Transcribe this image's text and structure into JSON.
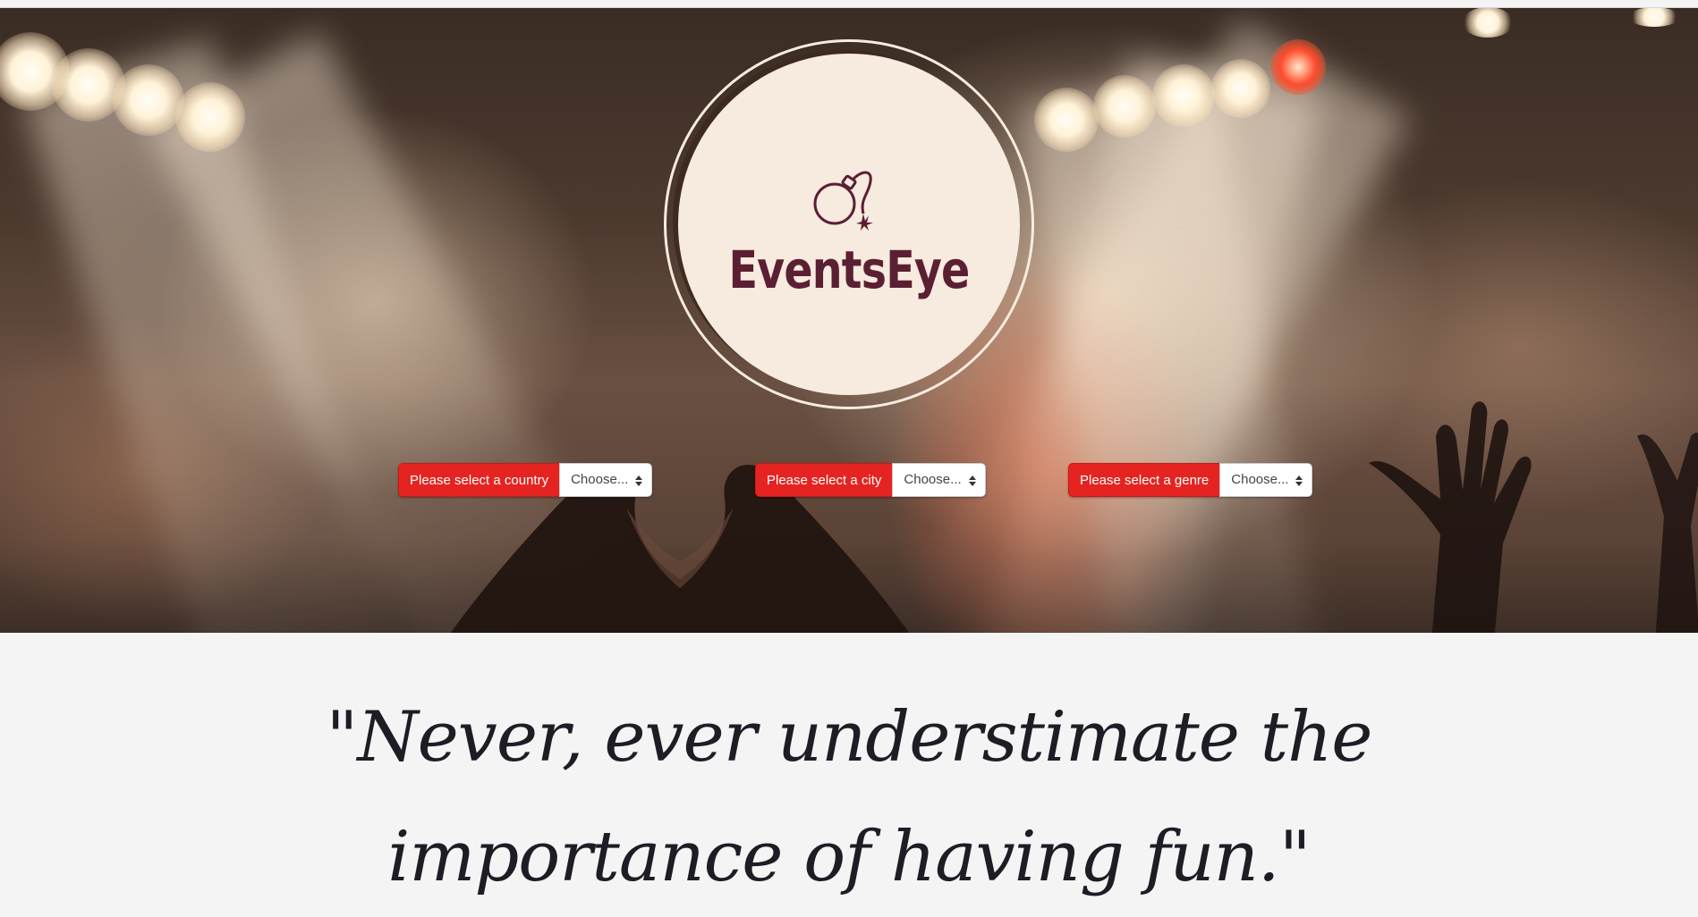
{
  "brand": {
    "name": "EventsEye",
    "icon": "bomb-icon",
    "color": "#5b1f33",
    "disc_color": "#f7eadf"
  },
  "filters": [
    {
      "label": "Please select a country",
      "value": "Choose...",
      "icon": "select-arrows-icon"
    },
    {
      "label": "Please select a city",
      "value": "Choose...",
      "icon": "select-arrows-icon"
    },
    {
      "label": "Please select a genre",
      "value": "Choose...",
      "icon": "select-arrows-icon"
    }
  ],
  "filter_label_color": "#e52421",
  "quote": {
    "text": "\"Never, ever understimate the importance of having fun.\"",
    "color": "#1c1d25"
  },
  "hero": {
    "image": "concert crowd heart hands photo"
  }
}
